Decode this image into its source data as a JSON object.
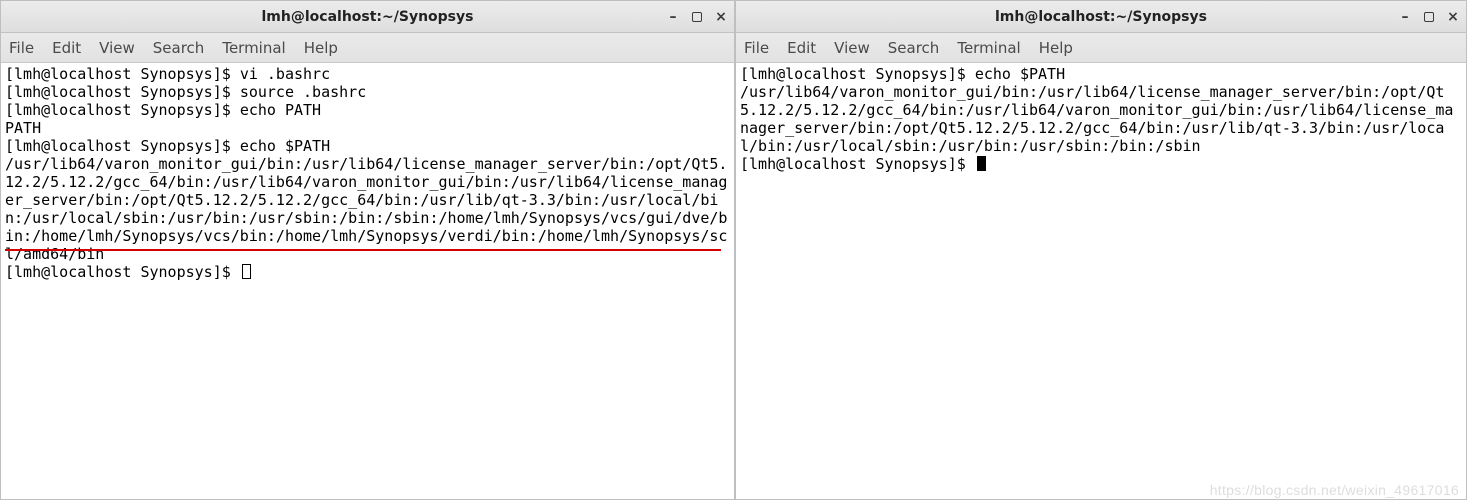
{
  "windows": {
    "left": {
      "title": "lmh@localhost:~/Synopsys",
      "controls": {
        "minimize": "–",
        "close": "×"
      },
      "menubar": [
        "File",
        "Edit",
        "View",
        "Search",
        "Terminal",
        "Help"
      ],
      "lines": {
        "p1": "[lmh@localhost Synopsys]$ ",
        "c1": "vi .bashrc",
        "p2": "[lmh@localhost Synopsys]$ ",
        "c2": "source .bashrc",
        "p3": "[lmh@localhost Synopsys]$ ",
        "c3": "echo PATH",
        "o1": "PATH",
        "p4": "[lmh@localhost Synopsys]$ ",
        "c4": "echo $PATH",
        "path": "/usr/lib64/varon_monitor_gui/bin:/usr/lib64/license_manager_server/bin:/opt/Qt5.12.2/5.12.2/gcc_64/bin:/usr/lib64/varon_monitor_gui/bin:/usr/lib64/license_manager_server/bin:/opt/Qt5.12.2/5.12.2/gcc_64/bin:/usr/lib/qt-3.3/bin:/usr/local/bin:/usr/local/sbin:/usr/bin:/usr/sbin:/bin:/sbin:/home/lmh/Synopsys/vcs/gui/dve/bin:/home/lmh/Synopsys/vcs/bin:/home/lmh/Synopsys/verdi/bin:/home/lmh/Synopsys/scl/amd64/bin",
        "p5": "[lmh@localhost Synopsys]$ "
      }
    },
    "right": {
      "title": "lmh@localhost:~/Synopsys",
      "controls": {
        "minimize": "–",
        "close": "×"
      },
      "menubar": [
        "File",
        "Edit",
        "View",
        "Search",
        "Terminal",
        "Help"
      ],
      "lines": {
        "p1": "[lmh@localhost Synopsys]$ ",
        "c1": "echo $PATH",
        "path": "/usr/lib64/varon_monitor_gui/bin:/usr/lib64/license_manager_server/bin:/opt/Qt5.12.2/5.12.2/gcc_64/bin:/usr/lib64/varon_monitor_gui/bin:/usr/lib64/license_manager_server/bin:/opt/Qt5.12.2/5.12.2/gcc_64/bin:/usr/lib/qt-3.3/bin:/usr/local/bin:/usr/local/sbin:/usr/bin:/usr/sbin:/bin:/sbin",
        "p2": "[lmh@localhost Synopsys]$ "
      }
    }
  },
  "watermark": "https://blog.csdn.net/weixin_49617016"
}
